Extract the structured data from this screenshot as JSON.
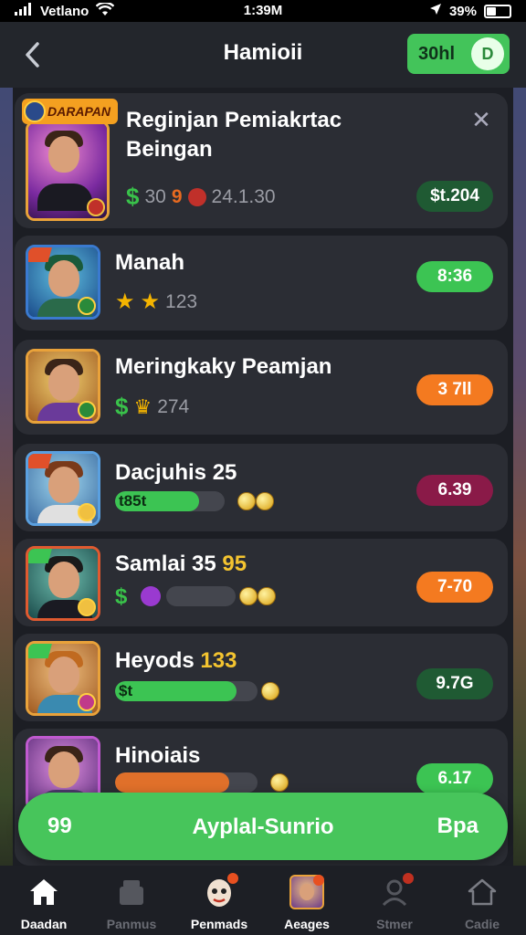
{
  "status_bar": {
    "carrier": "Vetlano",
    "time": "1:39M",
    "battery": "39%",
    "battery_level": 0.39
  },
  "header": {
    "title": "Hamioii",
    "badge_label": "30hl",
    "badge_coin": "D"
  },
  "games": [
    {
      "title_line1": "Reginjan Pemiakrtac",
      "title_line2": "Beingan",
      "meta_a": "30",
      "meta_b": "9",
      "meta_c": "24.1.30",
      "price": "$t.204",
      "price_color": "#1f5a33",
      "thumb_tag": "DARAPAN"
    },
    {
      "title": "Manah",
      "rating_text": "123",
      "price": "8:36",
      "price_color": "#3cc453"
    },
    {
      "title": "Meringkaky Peamjan",
      "meta_text": "274",
      "price": "3 7ll",
      "price_color": "#f47a20"
    },
    {
      "title": "Dacjuhis 25",
      "bar_text": "t85t",
      "progress": 0.77,
      "price": "6.39",
      "price_color": "#8a1a48"
    },
    {
      "title": "Samlai 35",
      "title_hl": "95",
      "progress": 0.0,
      "price": "7-70",
      "price_color": "#f47a20"
    },
    {
      "title": "Heyods",
      "title_hl": "133",
      "bar_text": "$t",
      "progress": 0.85,
      "price": "9.7G",
      "price_color": "#1f5a33"
    },
    {
      "title": "Hinoiais",
      "progress": 0.8,
      "price": "6.17",
      "price_color": "#3cc453"
    }
  ],
  "cta": {
    "left": "99",
    "label": "Ayplal-Sunrio",
    "right": "Bpa"
  },
  "tabs": [
    {
      "label": "Daadan",
      "icon": "home-icon"
    },
    {
      "label": "Panmus",
      "icon": "store-icon"
    },
    {
      "label": "Penmads",
      "icon": "mask-icon"
    },
    {
      "label": "Aeages",
      "icon": "avatar-icon"
    },
    {
      "label": "Stmer",
      "icon": "person-icon"
    },
    {
      "label": "Cadie",
      "icon": "house-outline-icon"
    }
  ]
}
